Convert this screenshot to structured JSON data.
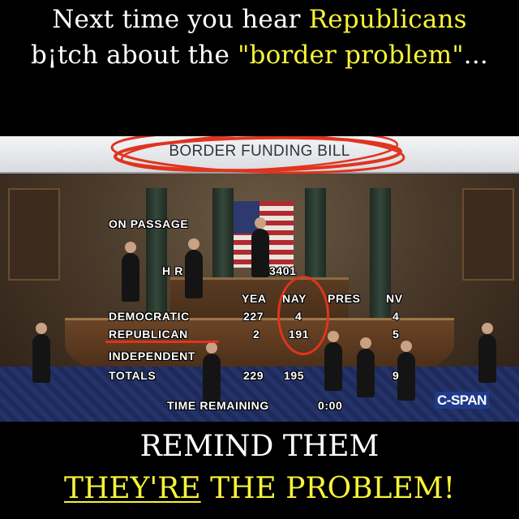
{
  "top_caption": {
    "line1_prefix": "Next time you hear ",
    "line1_highlight": "Republicans",
    "line2_prefix": "b¡tch about the ",
    "line2_highlight": "\"border problem\"",
    "line2_suffix": "..."
  },
  "frame": {
    "banner_text": "BORDER FUNDING BILL",
    "on_passage": "ON PASSAGE",
    "bill_prefix": "H R",
    "bill_number": "3401",
    "column_headers": [
      "YEA",
      "NAY",
      "PRES",
      "NV"
    ],
    "rows": [
      {
        "label": "DEMOCRATIC",
        "yea": "227",
        "nay": "4",
        "pres": "",
        "nv": "4"
      },
      {
        "label": "REPUBLICAN",
        "yea": "2",
        "nay": "191",
        "pres": "",
        "nv": "5"
      },
      {
        "label": "INDEPENDENT",
        "yea": "",
        "nay": "",
        "pres": "",
        "nv": ""
      },
      {
        "label": "TOTALS",
        "yea": "229",
        "nay": "195",
        "pres": "",
        "nv": "9"
      }
    ],
    "time_remaining_label": "TIME REMAINING",
    "time_remaining_value": "0:00",
    "network_logo": "C-SPAN"
  },
  "bottom_caption": {
    "line1": "REMIND THEM",
    "line2_underlined": "THEY'RE",
    "line2_rest": " THE PROBLEM!"
  },
  "colors": {
    "highlight_yellow": "#f7f339",
    "annotation_red": "#e0341e",
    "background": "#000000"
  }
}
